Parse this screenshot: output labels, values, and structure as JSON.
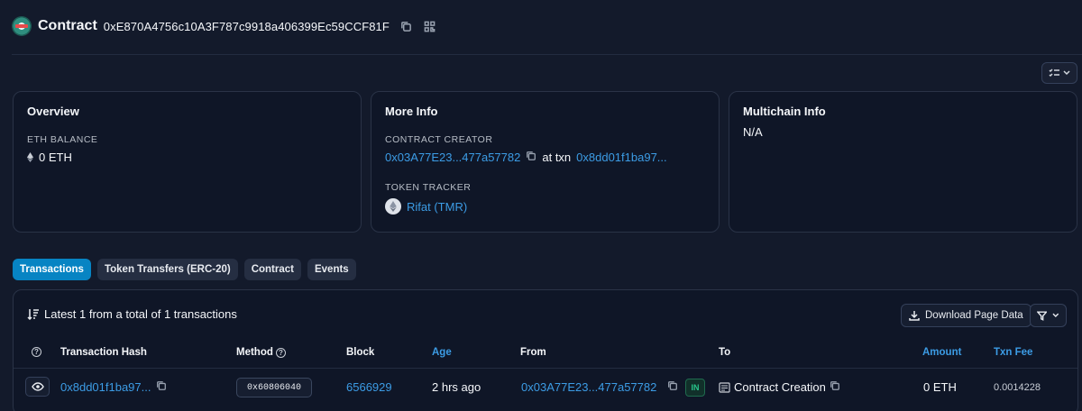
{
  "header": {
    "title": "Contract",
    "address": "0xE870A4756c10A3F787c9918a406399Ec59CCF81F"
  },
  "cards": {
    "overview": {
      "title": "Overview",
      "balance_label": "ETH BALANCE",
      "balance_value": "0 ETH"
    },
    "more_info": {
      "title": "More Info",
      "creator_label": "CONTRACT CREATOR",
      "creator_address": "0x03A77E23...477a57782",
      "at_txn_text": "at txn",
      "creator_txn": "0x8dd01f1ba97...",
      "tracker_label": "TOKEN TRACKER",
      "tracker_value": "Rifat (TMR)"
    },
    "multichain": {
      "title": "Multichain Info",
      "value": "N/A"
    }
  },
  "tabs": [
    {
      "label": "Transactions",
      "active": true
    },
    {
      "label": "Token Transfers (ERC-20)",
      "active": false
    },
    {
      "label": "Contract",
      "active": false
    },
    {
      "label": "Events",
      "active": false
    }
  ],
  "transactions": {
    "summary": "Latest 1 from a total of 1 transactions",
    "download_label": "Download Page Data",
    "columns": {
      "hash": "Transaction Hash",
      "method": "Method",
      "block": "Block",
      "age": "Age",
      "from": "From",
      "to": "To",
      "amount": "Amount",
      "fee": "Txn Fee"
    },
    "rows": [
      {
        "hash": "0x8dd01f1ba97...",
        "method": "0x60806040",
        "block": "6566929",
        "age": "2 hrs ago",
        "from": "0x03A77E23...477a57782",
        "direction": "IN",
        "to": "Contract Creation",
        "amount": "0 ETH",
        "fee": "0.0014228"
      }
    ]
  },
  "colors": {
    "background": "#131a2b",
    "card": "#0f1627",
    "accent": "#0784c3",
    "link": "#3c9ce5",
    "in_badge": "#28c58b"
  }
}
